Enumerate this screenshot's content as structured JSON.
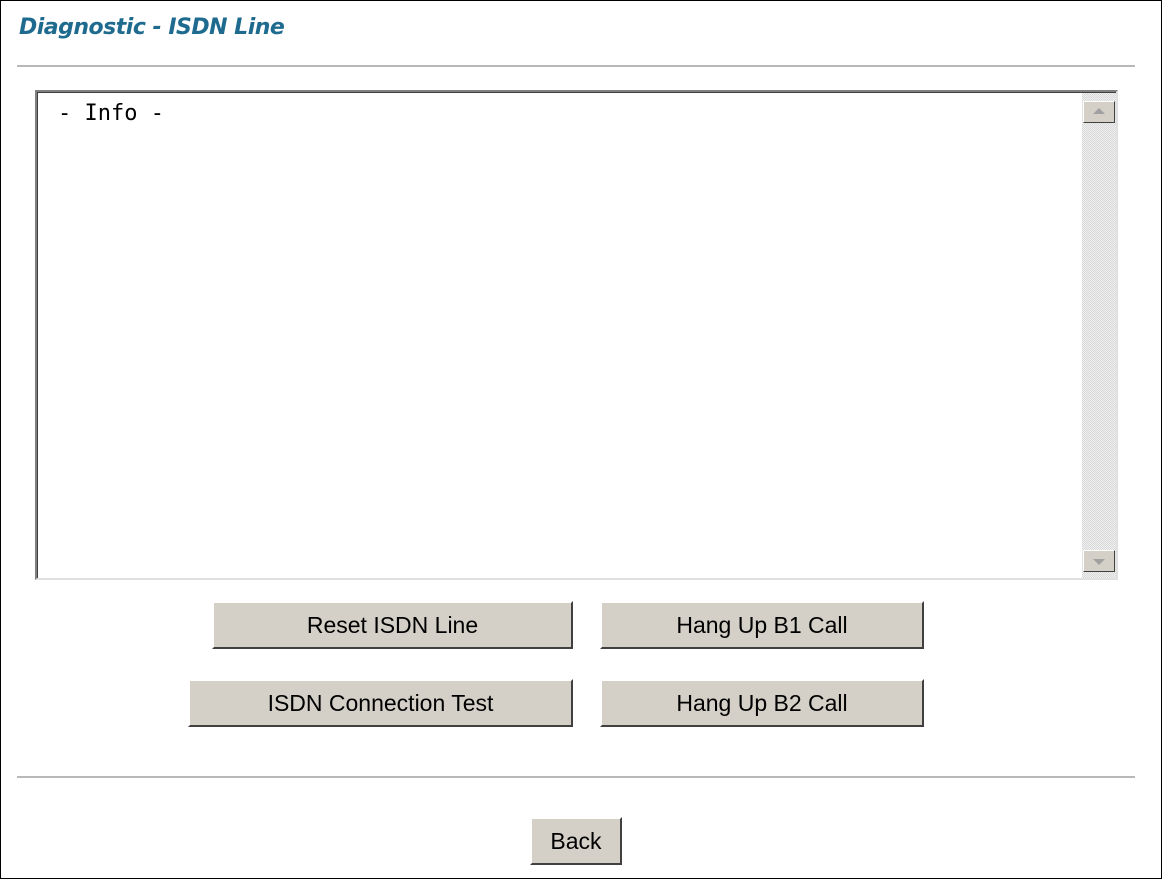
{
  "page": {
    "title": "Diagnostic - ISDN Line",
    "title_color": "#1f6b8f"
  },
  "info_box": {
    "content": "- Info -"
  },
  "buttons": {
    "reset_isdn_line": "Reset ISDN Line",
    "hang_up_b1": "Hang Up B1 Call",
    "isdn_connection_test": "ISDN Connection Test",
    "hang_up_b2": "Hang Up B2 Call",
    "back": "Back"
  },
  "scrollbar": {
    "up_icon": "scroll-up-arrow",
    "down_icon": "scroll-down-arrow"
  }
}
